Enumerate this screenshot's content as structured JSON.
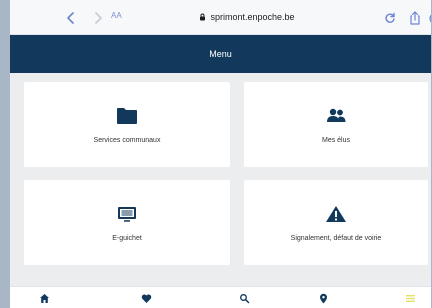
{
  "browser": {
    "address": "sprimont.enpoche.be",
    "text_size_label": "AA"
  },
  "header": {
    "title": "Menu"
  },
  "cards": [
    {
      "label": "Services communaux",
      "icon": "folder-icon"
    },
    {
      "label": "Mes élus",
      "icon": "people-icon"
    },
    {
      "label": "E-guichet",
      "icon": "terminal-icon"
    },
    {
      "label": "Signalement, défaut de voirie",
      "icon": "warning-icon"
    }
  ],
  "bottom_nav": [
    {
      "icon": "home-icon"
    },
    {
      "icon": "heart-icon"
    },
    {
      "icon": "search-icon"
    },
    {
      "icon": "location-pin-icon"
    },
    {
      "icon": "menu-icon"
    }
  ],
  "colors": {
    "header_bg": "#12395b",
    "icon_dark": "#12395b",
    "browser_accent": "#5d73d1",
    "menu_accent": "#e5e06a"
  }
}
